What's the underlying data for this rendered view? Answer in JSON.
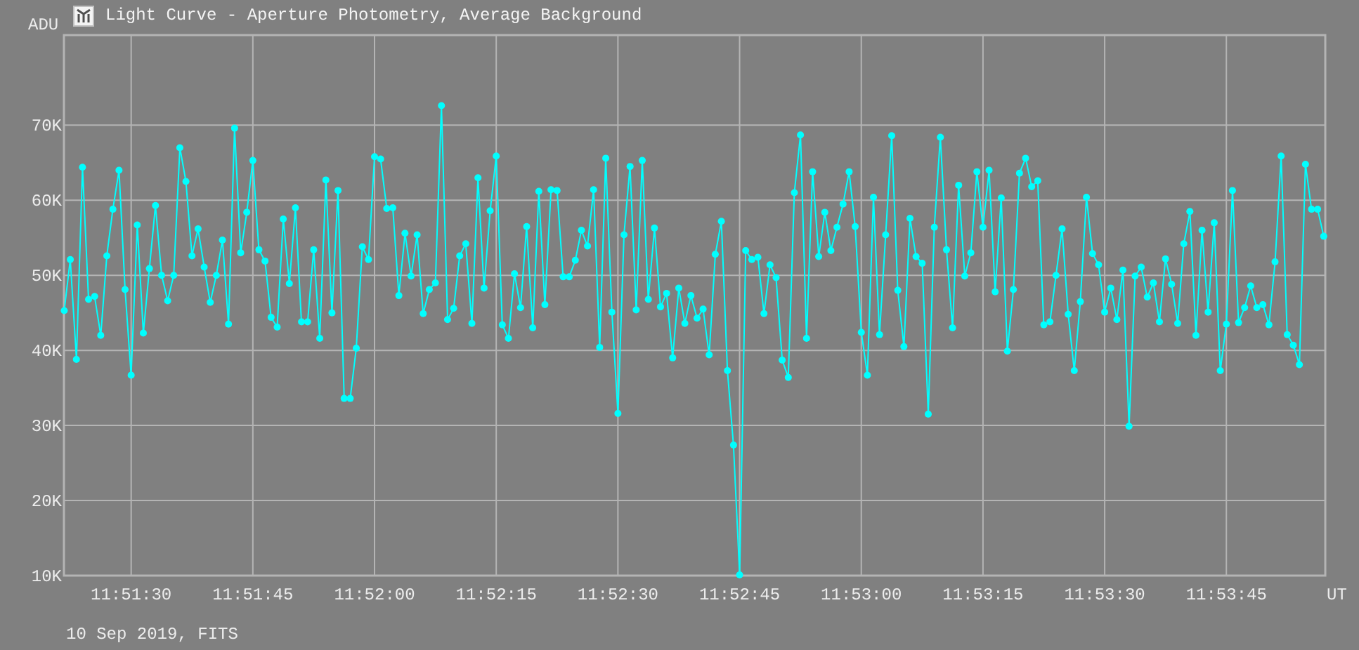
{
  "window": {
    "title": "Light Curve - Aperture Photometry, Average Background"
  },
  "chart": {
    "chart_data": {
      "type": "line",
      "xlabel": "UT",
      "ylabel": "ADU",
      "categories": [
        null,
        null,
        null,
        null,
        null,
        null,
        null,
        null,
        null,
        null,
        null,
        "11:51:30",
        null,
        null,
        null,
        null,
        null,
        null,
        null,
        null,
        null,
        null,
        null,
        null,
        null,
        null,
        null,
        null,
        null,
        null,
        null,
        "11:51:45",
        null,
        null,
        null,
        null,
        null,
        null,
        null,
        null,
        null,
        null,
        null,
        null,
        null,
        null,
        null,
        null,
        null,
        null,
        null,
        "11:52:00",
        null,
        null,
        null,
        null,
        null,
        null,
        null,
        null,
        null,
        null,
        null,
        null,
        null,
        null,
        null,
        null,
        null,
        null,
        null,
        "11:52:15",
        null,
        null,
        null,
        null,
        null,
        null,
        null,
        null,
        null,
        null,
        null,
        null,
        null,
        null,
        null,
        null,
        null,
        null,
        null,
        "11:52:30",
        null,
        null,
        null,
        null,
        null,
        null,
        null,
        null,
        null,
        null,
        null,
        null,
        null,
        null,
        null,
        null,
        null,
        null,
        null,
        "11:52:45",
        null,
        null,
        null,
        null,
        null,
        null,
        null,
        null,
        null,
        null,
        null,
        null,
        null,
        null,
        null,
        null,
        null,
        null,
        null,
        "11:53:00",
        null,
        null,
        null,
        null,
        null,
        null,
        null,
        null,
        null,
        null,
        null,
        null,
        null,
        null,
        null,
        null,
        null,
        null,
        null,
        "11:53:15",
        null,
        null,
        null,
        null,
        null,
        null,
        null,
        null,
        null,
        null,
        null,
        null,
        null,
        null,
        null,
        null,
        null,
        null,
        null,
        "11:53:30",
        null,
        null,
        null,
        null,
        null,
        null,
        null,
        null,
        null,
        null,
        null,
        null,
        null,
        null,
        null,
        null,
        null,
        null,
        null,
        "11:53:45",
        null,
        null,
        null,
        null,
        null,
        null,
        null,
        null,
        null,
        null,
        null,
        null,
        null,
        null,
        null,
        null
      ],
      "grid": true,
      "series": [
        {
          "color": "#00ffff",
          "marker": "circle",
          "values": [
            45300,
            52100,
            38800,
            64400,
            46800,
            47200,
            42000,
            52600,
            58800,
            64000,
            48100,
            36700,
            56700,
            42300,
            50900,
            59300,
            50000,
            46600,
            50000,
            67000,
            62500,
            52600,
            56200,
            51100,
            46400,
            50000,
            54700,
            43500,
            69600,
            53000,
            58400,
            65300,
            53400,
            51900,
            44400,
            43100,
            57500,
            48900,
            59000,
            43800,
            43800,
            53400,
            41600,
            62700,
            45000,
            61300,
            33600,
            33600,
            40300,
            53800,
            52100,
            65800,
            65500,
            58900,
            59000,
            47300,
            55600,
            49900,
            55400,
            44900,
            48100,
            49000,
            72600,
            44100,
            45600,
            52600,
            54200,
            43600,
            63000,
            48300,
            58600,
            65900,
            43400,
            41600,
            50200,
            45700,
            56500,
            43000,
            61200,
            46100,
            61400,
            61300,
            49800,
            49800,
            52000,
            56000,
            53900,
            61400,
            40400,
            65600,
            45100,
            31600,
            55400,
            64500,
            45400,
            65300,
            46800,
            56300,
            45800,
            47600,
            39000,
            48300,
            43600,
            47300,
            44300,
            45500,
            39400,
            52800,
            57200,
            37300,
            27400,
            10100,
            53300,
            52100,
            52400,
            44900,
            51400,
            49700,
            38700,
            36400,
            61000,
            68700,
            41600,
            63800,
            52500,
            58400,
            53300,
            56400,
            59500,
            63800,
            56500,
            42400,
            36700,
            60400,
            42100,
            55400,
            68600,
            48000,
            40500,
            57600,
            52500,
            51600,
            31500,
            56400,
            68400,
            53400,
            43000,
            62000,
            49900,
            53000,
            63800,
            56400,
            64000,
            47800,
            60300,
            39900,
            48100,
            63600,
            65600,
            61800,
            62600,
            43400,
            43800,
            50000,
            56200,
            44800,
            37300,
            46500,
            60400,
            52900,
            51400,
            45100,
            48300,
            44100,
            50700,
            29900,
            49900,
            51100,
            47100,
            49000,
            43800,
            52200,
            48800,
            43600,
            54200,
            58500,
            42000,
            56000,
            45100,
            57000,
            37300,
            43500,
            61300,
            43700,
            45700,
            48600,
            45700,
            46100,
            43400,
            51800,
            65900,
            42100,
            40700,
            38100,
            64800,
            58800,
            58800,
            55200
          ]
        }
      ],
      "ylim": [
        10000,
        82000
      ],
      "yticks": [
        {
          "value": 10000,
          "label": "10K"
        },
        {
          "value": 20000,
          "label": "20K"
        },
        {
          "value": 30000,
          "label": "30K"
        },
        {
          "value": 40000,
          "label": "40K"
        },
        {
          "value": 50000,
          "label": "50K"
        },
        {
          "value": 60000,
          "label": "60K"
        },
        {
          "value": 70000,
          "label": "70K"
        }
      ]
    }
  },
  "footer": {
    "text": "10 Sep 2019, FITS"
  }
}
